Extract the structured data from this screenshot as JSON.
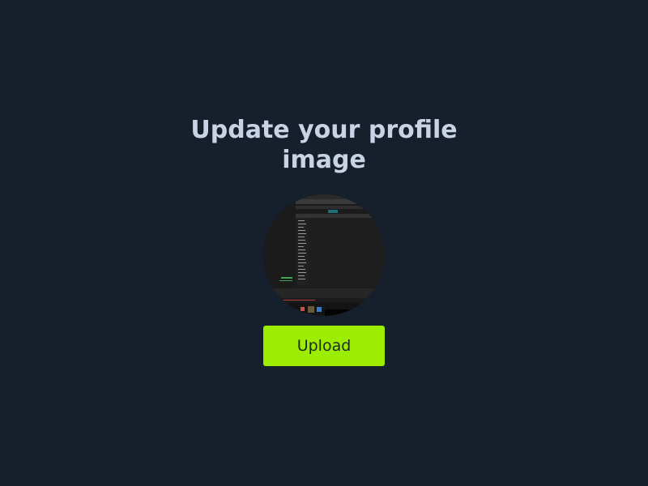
{
  "profile": {
    "title": "Update your profile image",
    "avatar_icon": "profile-image"
  },
  "upload": {
    "label": "Upload"
  },
  "colors": {
    "background": "#161f2c",
    "title": "#c9d3e6",
    "button": "#9ded03",
    "button_text": "#1d2a22"
  }
}
